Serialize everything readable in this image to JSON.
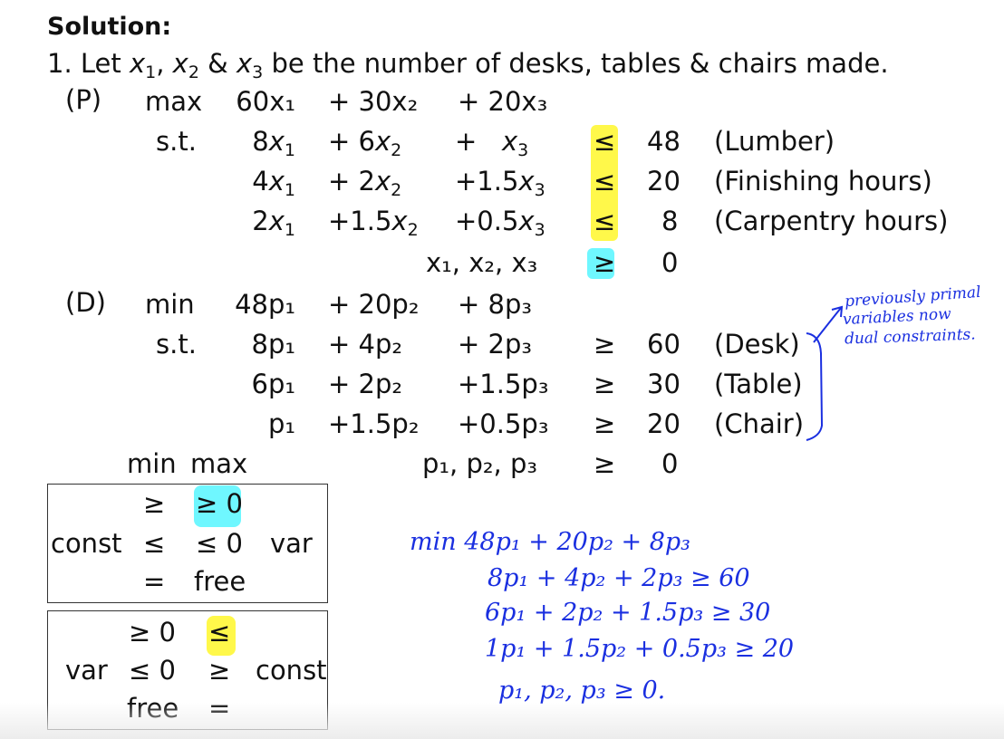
{
  "heading": "Solution:",
  "intro": {
    "prefix": "1. Let",
    "vars": [
      "x",
      "x",
      "x"
    ],
    "subs": [
      "1",
      "2",
      "3"
    ],
    "sep1": ",",
    "sep2": "&",
    "suffix": "be the number of desks, tables & chairs made."
  },
  "primal": {
    "label": "(P)",
    "objective_sense": "max",
    "st": "s.t.",
    "objective": [
      "60x₁",
      "+ 30x₂",
      "+ 20x₃"
    ],
    "constraints": [
      {
        "t1": "8",
        "t2": "+ 6",
        "t3": "+",
        "rel": "≤",
        "rhs": "48",
        "name": "(Lumber)",
        "highlight": "yellow"
      },
      {
        "t1": "4",
        "t2": "+ 2",
        "t3": "+1.5",
        "rel": "≤",
        "rhs": "20",
        "name": "(Finishing hours)",
        "highlight": "yellow"
      },
      {
        "t1": "2",
        "t2": "+1.5",
        "t3": "+0.5",
        "rel": "≤",
        "rhs": "8",
        "name": "(Carpentry hours)",
        "highlight": "yellow"
      }
    ],
    "nonneg": {
      "vars": "x₁, x₂, x₃",
      "rel": "≥",
      "rhs": "0",
      "highlight": "cyan"
    }
  },
  "dual": {
    "label": "(D)",
    "objective_sense": "min",
    "st": "s.t.",
    "objective": [
      "48p₁",
      "+ 20p₂",
      "+ 8p₃"
    ],
    "constraints": [
      {
        "t1": "8p₁",
        "t2": "+ 4p₂",
        "t3": "+ 2p₃",
        "rel": "≥",
        "rhs": "60",
        "name": "(Desk)"
      },
      {
        "t1": "6p₁",
        "t2": "+ 2p₂",
        "t3": "+1.5p₃",
        "rel": "≥",
        "rhs": "30",
        "name": "(Table)"
      },
      {
        "t1": "p₁",
        "t2": "+1.5p₂",
        "t3": "+0.5p₃",
        "rel": "≥",
        "rhs": "20",
        "name": "(Chair)"
      }
    ],
    "nonneg": {
      "vars": "p₁, p₂, p₃",
      "rel": "≥",
      "rhs": "0"
    }
  },
  "annotation": {
    "lines": [
      "previously primal",
      "variables now",
      "dual constraints."
    ],
    "color": "#1a2fe0"
  },
  "table_header": {
    "min": "min",
    "max": "max"
  },
  "box1": {
    "left_label": "const",
    "right_label": "var",
    "rows": [
      {
        "min": "≥",
        "max": "≥ 0"
      },
      {
        "min": "≤",
        "max": "≤ 0"
      },
      {
        "min": "=",
        "max": "free"
      }
    ]
  },
  "box2": {
    "left_label": "var",
    "right_label": "const",
    "rows": [
      {
        "min": "≥ 0",
        "max": "≤"
      },
      {
        "min": "≤ 0",
        "max": "≥"
      },
      {
        "min": "free",
        "max": "="
      }
    ]
  },
  "handwritten": {
    "lines": [
      "min 48p₁ + 20p₂ + 8p₃",
      "8p₁ + 4p₂ + 2p₃ ≥ 60",
      "6p₁ + 2p₂ + 1.5p₃ ≥ 30",
      "1p₁ + 1.5p₂ + 0.5p₃ ≥ 20",
      "p₁, p₂, p₃ ≥ 0."
    ]
  },
  "colors": {
    "highlight_yellow": "#fff84a",
    "highlight_cyan": "#6ff7ff",
    "ink_blue": "#1a2fe0"
  }
}
